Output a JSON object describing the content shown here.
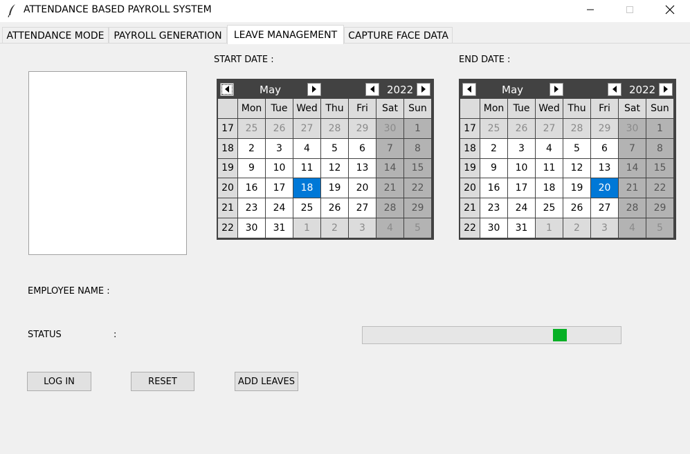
{
  "window": {
    "title": "ATTENDANCE BASED PAYROLL SYSTEM",
    "icons": {
      "app": "feather-icon",
      "minimize": "minimize-icon",
      "maximize": "maximize-icon",
      "close": "close-icon"
    }
  },
  "tabs": [
    {
      "label": "ATTENDANCE MODE",
      "active": false
    },
    {
      "label": "PAYROLL GENERATION",
      "active": false
    },
    {
      "label": "LEAVE MANAGEMENT",
      "active": true
    },
    {
      "label": "CAPTURE FACE DATA",
      "active": false
    }
  ],
  "form": {
    "start_date_label": "START DATE  :",
    "end_date_label": "END DATE  :",
    "employee_name_label": "EMPLOYEE NAME  :",
    "status_label": "STATUS",
    "status_colon": ":",
    "buttons": {
      "login": "LOG IN",
      "reset": "RESET",
      "add_leaves": "ADD LEAVES"
    }
  },
  "progress": {
    "indeterminate": true,
    "block_position_fraction": 0.78,
    "color": "#06b025"
  },
  "weekday_headers": [
    "Mon",
    "Tue",
    "Wed",
    "Thu",
    "Fri",
    "Sat",
    "Sun"
  ],
  "calendars": {
    "start": {
      "month": "May",
      "year": "2022",
      "selected_day": "18",
      "weeks": [
        {
          "week": "17",
          "days": [
            "25",
            "26",
            "27",
            "28",
            "29",
            "30",
            "1"
          ],
          "other": [
            true,
            true,
            true,
            true,
            true,
            true,
            false
          ]
        },
        {
          "week": "18",
          "days": [
            "2",
            "3",
            "4",
            "5",
            "6",
            "7",
            "8"
          ],
          "other": [
            false,
            false,
            false,
            false,
            false,
            false,
            false
          ]
        },
        {
          "week": "19",
          "days": [
            "9",
            "10",
            "11",
            "12",
            "13",
            "14",
            "15"
          ],
          "other": [
            false,
            false,
            false,
            false,
            false,
            false,
            false
          ]
        },
        {
          "week": "20",
          "days": [
            "16",
            "17",
            "18",
            "19",
            "20",
            "21",
            "22"
          ],
          "other": [
            false,
            false,
            false,
            false,
            false,
            false,
            false
          ]
        },
        {
          "week": "21",
          "days": [
            "23",
            "24",
            "25",
            "26",
            "27",
            "28",
            "29"
          ],
          "other": [
            false,
            false,
            false,
            false,
            false,
            false,
            false
          ]
        },
        {
          "week": "22",
          "days": [
            "30",
            "31",
            "1",
            "2",
            "3",
            "4",
            "5"
          ],
          "other": [
            false,
            false,
            true,
            true,
            true,
            true,
            true
          ]
        }
      ]
    },
    "end": {
      "month": "May",
      "year": "2022",
      "selected_day": "20",
      "weeks": [
        {
          "week": "17",
          "days": [
            "25",
            "26",
            "27",
            "28",
            "29",
            "30",
            "1"
          ],
          "other": [
            true,
            true,
            true,
            true,
            true,
            true,
            false
          ]
        },
        {
          "week": "18",
          "days": [
            "2",
            "3",
            "4",
            "5",
            "6",
            "7",
            "8"
          ],
          "other": [
            false,
            false,
            false,
            false,
            false,
            false,
            false
          ]
        },
        {
          "week": "19",
          "days": [
            "9",
            "10",
            "11",
            "12",
            "13",
            "14",
            "15"
          ],
          "other": [
            false,
            false,
            false,
            false,
            false,
            false,
            false
          ]
        },
        {
          "week": "20",
          "days": [
            "16",
            "17",
            "18",
            "19",
            "20",
            "21",
            "22"
          ],
          "other": [
            false,
            false,
            false,
            false,
            false,
            false,
            false
          ]
        },
        {
          "week": "21",
          "days": [
            "23",
            "24",
            "25",
            "26",
            "27",
            "28",
            "29"
          ],
          "other": [
            false,
            false,
            false,
            false,
            false,
            false,
            false
          ]
        },
        {
          "week": "22",
          "days": [
            "30",
            "31",
            "1",
            "2",
            "3",
            "4",
            "5"
          ],
          "other": [
            false,
            false,
            true,
            true,
            true,
            true,
            true
          ]
        }
      ]
    }
  },
  "colors": {
    "calendar_header_bg": "#424242",
    "weekday_bg": "#ffffff",
    "weekend_bg": "#b3b3b3",
    "other_month_weekday_bg": "#dcdcdc",
    "other_month_text": "#8a8a8a",
    "selected_bg": "#0078d7",
    "week_number_bg": "#dcdcdc"
  }
}
